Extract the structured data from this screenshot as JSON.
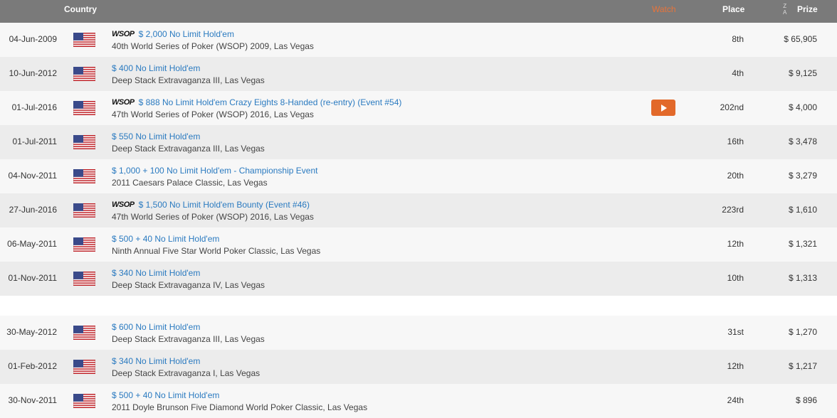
{
  "header": {
    "country": "Country",
    "watch": "Watch",
    "place": "Place",
    "sort_z": "Z",
    "sort_a": "A",
    "prize": "Prize"
  },
  "rows": [
    {
      "date": "04-Jun-2009",
      "wsop": true,
      "wsop_logo": "WSOP",
      "title": "$ 2,000 No Limit Hold'em",
      "subtitle": "40th World Series of Poker (WSOP) 2009, Las Vegas",
      "watch": false,
      "place": "8th",
      "prize": "$ 65,905"
    },
    {
      "date": "10-Jun-2012",
      "wsop": false,
      "title": "$ 400 No Limit Hold'em",
      "subtitle": "Deep Stack Extravaganza III, Las Vegas",
      "watch": false,
      "place": "4th",
      "prize": "$ 9,125"
    },
    {
      "date": "01-Jul-2016",
      "wsop": true,
      "wsop_logo": "WSOP",
      "title": "$ 888 No Limit Hold'em Crazy Eights 8-Handed (re-entry) (Event #54)",
      "subtitle": "47th World Series of Poker (WSOP) 2016, Las Vegas",
      "watch": true,
      "place": "202nd",
      "prize": "$ 4,000"
    },
    {
      "date": "01-Jul-2011",
      "wsop": false,
      "title": "$ 550 No Limit Hold'em",
      "subtitle": "Deep Stack Extravaganza III, Las Vegas",
      "watch": false,
      "place": "16th",
      "prize": "$ 3,478"
    },
    {
      "date": "04-Nov-2011",
      "wsop": false,
      "title": "$ 1,000 + 100 No Limit Hold'em - Championship Event",
      "subtitle": "2011 Caesars Palace Classic, Las Vegas",
      "watch": false,
      "place": "20th",
      "prize": "$ 3,279"
    },
    {
      "date": "27-Jun-2016",
      "wsop": true,
      "wsop_logo": "WSOP",
      "title": "$ 1,500 No Limit Hold'em Bounty (Event #46)",
      "subtitle": "47th World Series of Poker (WSOP) 2016, Las Vegas",
      "watch": false,
      "place": "223rd",
      "prize": "$ 1,610"
    },
    {
      "date": "06-May-2011",
      "wsop": false,
      "title": "$ 500 + 40 No Limit Hold'em",
      "subtitle": "Ninth Annual Five Star World Poker Classic, Las Vegas",
      "watch": false,
      "place": "12th",
      "prize": "$ 1,321"
    },
    {
      "date": "01-Nov-2011",
      "wsop": false,
      "title": "$ 340 No Limit Hold'em",
      "subtitle": "Deep Stack Extravaganza IV, Las Vegas",
      "watch": false,
      "place": "10th",
      "prize": "$ 1,313"
    },
    {
      "date": "30-May-2012",
      "wsop": false,
      "title": "$ 600 No Limit Hold'em",
      "subtitle": "Deep Stack Extravaganza III, Las Vegas",
      "watch": false,
      "place": "31st",
      "prize": "$ 1,270"
    },
    {
      "date": "01-Feb-2012",
      "wsop": false,
      "title": "$ 340 No Limit Hold'em",
      "subtitle": "Deep Stack Extravaganza I, Las Vegas",
      "watch": false,
      "place": "12th",
      "prize": "$ 1,217"
    },
    {
      "date": "30-Nov-2011",
      "wsop": false,
      "title": "$ 500 + 40 No Limit Hold'em",
      "subtitle": "2011 Doyle Brunson Five Diamond World Poker Classic, Las Vegas",
      "watch": false,
      "place": "24th",
      "prize": "$ 896"
    }
  ],
  "colors": {
    "header_bg": "#7a7a7a",
    "link": "#2a7ac0",
    "watch_accent": "#e2692a"
  }
}
